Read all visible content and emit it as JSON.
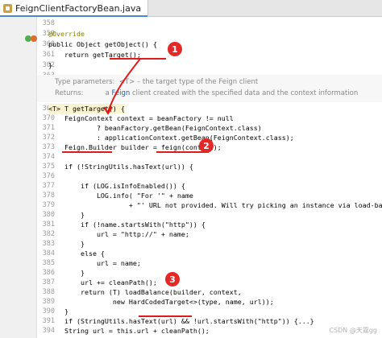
{
  "tab": {
    "title": "FeignClientFactoryBean.java"
  },
  "doc_comment": {
    "line1_label": "Type parameters:",
    "line1_value": "<T> – the target type of the Feign client",
    "line2_label": "Returns:",
    "line2_prefix": "a ",
    "line2_link": "Feign",
    "line2_suffix": " client created with the specified data and the context information"
  },
  "lines": [
    {
      "n": "358",
      "code": ""
    },
    {
      "n": "359",
      "code": "@Override"
    },
    {
      "n": "360",
      "code": "public Object getObject() {"
    },
    {
      "n": "361",
      "code": "    return getTarget();"
    },
    {
      "n": "362",
      "code": "}"
    },
    {
      "n": "363",
      "code": ""
    },
    {
      "n": "364",
      "code": ""
    },
    {
      "n": "369",
      "code": "<T> T getTarget() {"
    },
    {
      "n": "370",
      "code": "    FeignContext context = beanFactory != null"
    },
    {
      "n": "371",
      "code": "            ? beanFactory.getBean(FeignContext.class)"
    },
    {
      "n": "372",
      "code": "            : applicationContext.getBean(FeignContext.class);"
    },
    {
      "n": "373",
      "code": "    Feign.Builder builder = feign(context);"
    },
    {
      "n": "374",
      "code": ""
    },
    {
      "n": "375",
      "code": "    if (!StringUtils.hasText(url)) {"
    },
    {
      "n": "376",
      "code": ""
    },
    {
      "n": "377",
      "code": "        if (LOG.isInfoEnabled()) {"
    },
    {
      "n": "378",
      "code": "            LOG.info( \"For '\" + name"
    },
    {
      "n": "379",
      "code": "                    + \"' URL not provided. Will try picking an instance via load-balancing.\");"
    },
    {
      "n": "380",
      "code": "        }"
    },
    {
      "n": "381",
      "code": "        if (!name.startsWith(\"http\")) {"
    },
    {
      "n": "382",
      "code": "            url = \"http://\" + name;"
    },
    {
      "n": "383",
      "code": "        }"
    },
    {
      "n": "384",
      "code": "        else {"
    },
    {
      "n": "385",
      "code": "            url = name;"
    },
    {
      "n": "386",
      "code": "        }"
    },
    {
      "n": "387",
      "code": "        url += cleanPath();"
    },
    {
      "n": "388",
      "code": "        return (T) loadBalance(builder, context,"
    },
    {
      "n": "389",
      "code": "                new HardCodedTarget<>(type, name, url));"
    },
    {
      "n": "390",
      "code": "    }"
    },
    {
      "n": "391",
      "code": "    if (StringUtils.hasText(url) && !url.startsWith(\"http\")) {...}"
    },
    {
      "n": "394",
      "code": "    String url = this.url + cleanPath();"
    }
  ],
  "badges": [
    "1",
    "2",
    "3"
  ],
  "watermark": "CSDN @天霆gg",
  "colors": {
    "annotation": "#808000",
    "keyword": "#000080",
    "string": "#067d17",
    "marker": "#e01b1b"
  }
}
